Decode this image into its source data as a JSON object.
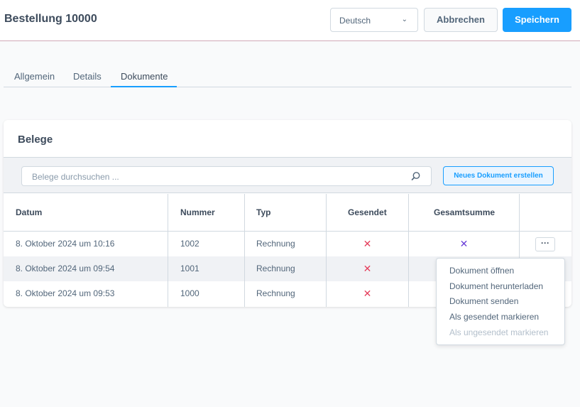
{
  "header": {
    "title": "Bestellung 10000",
    "language": "Deutsch",
    "cancel_label": "Abbrechen",
    "save_label": "Speichern",
    "accent_color": "#189eff"
  },
  "tabs": [
    {
      "label": "Allgemein",
      "active": false
    },
    {
      "label": "Details",
      "active": false
    },
    {
      "label": "Dokumente",
      "active": true
    }
  ],
  "documents": {
    "title": "Belege",
    "search_placeholder": "Belege durchsuchen ...",
    "new_button_label": "Neues Dokument erstellen",
    "columns": [
      "Datum",
      "Nummer",
      "Typ",
      "Gesendet",
      "Gesamtsumme"
    ],
    "rows": [
      {
        "date": "8. Oktober 2024 um 10:16",
        "number": "1002",
        "type": "Rechnung",
        "sent": "✕",
        "total": "✕"
      },
      {
        "date": "8. Oktober 2024 um 09:54",
        "number": "1001",
        "type": "Rechnung",
        "sent": "✕",
        "total": ""
      },
      {
        "date": "8. Oktober 2024 um 09:53",
        "number": "1000",
        "type": "Rechnung",
        "sent": "✕",
        "total": ""
      }
    ],
    "context_button_label": "···"
  },
  "context_menu": {
    "items": [
      {
        "label": "Dokument öffnen",
        "disabled": false
      },
      {
        "label": "Dokument herunterladen",
        "disabled": false
      },
      {
        "label": "Dokument senden",
        "disabled": false
      },
      {
        "label": "Als gesendet markieren",
        "disabled": false
      },
      {
        "label": "Als ungesendet markieren",
        "disabled": true
      }
    ]
  }
}
